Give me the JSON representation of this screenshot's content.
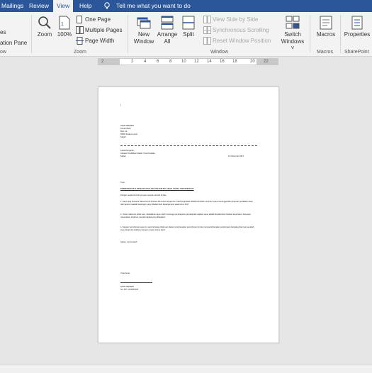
{
  "tabs": [
    "Mailings",
    "Review",
    "View",
    "Help"
  ],
  "tell_me": "Tell me what you want to do",
  "ribbon": {
    "partial_left": [
      "es",
      "ation Pane",
      "ow"
    ],
    "zoom": {
      "zoom": "Zoom",
      "pct": "100%",
      "one_page": "One Page",
      "multiple_pages": "Multiple Pages",
      "page_width": "Page Width",
      "group": "Zoom"
    },
    "window": {
      "new_window": [
        "New",
        "Window"
      ],
      "arrange_all": [
        "Arrange",
        "All"
      ],
      "split": "Split",
      "side_by_side": "View Side by Side",
      "sync_scroll": "Synchronous Scrolling",
      "reset_pos": "Reset Window Position",
      "switch": [
        "Switch",
        "Windows ˅"
      ],
      "group": "Window"
    },
    "macros": {
      "label": "Macros",
      "group": "Macros"
    },
    "sharepoint": {
      "label": "Properties",
      "group": "SharePoint"
    }
  },
  "ruler": {
    "ticks": [
      "2",
      "2",
      "4",
      "6",
      "8",
      "10",
      "12",
      "14",
      "16",
      "18",
      "20",
      "22"
    ]
  },
  "document": {
    "sender": [
      "NAMA SENDER",
      "Taman Book,",
      "Blok 1/2,",
      "56000 Kuala Lumpur,",
      "Sabah."
    ],
    "recipient": [
      "Ketua Pengarah,",
      "Jabatan Pendidikan Sabah, Kota Kinabalu,",
      "Sabah."
    ],
    "date": "21 November 2017",
    "salutation": "Tuan,",
    "subject": "PERMOHONAN PENANGGUHAN PINJAMAN ANAK MARA PENDIDIKAN",
    "greeting": "Dengan segala hormatnya saya merujuk perkara di atas.",
    "paragraphs": [
      "2.    Saya yang bernama Nama Penuh di Nama Pemohon dengan No. Kad Pengenalan 000000-00-0000 memohon untuk menangguhkan pinjaman pendidikan saya oleh kerana masalah kewangan yang dihadapi oleh keluarga saya sejak tahun 2017.",
      "3.    Untuk makluman pihak tuan, disebabkan saya masih menunggu pembayaran gaji daripada majikan saya, adalah dimaklumkan bahawa saya belum berupaya melunaskan pinjaman mengikut jadual yang ditetapkan.",
      "4.    Dengan permohonan saya ini, saya berharap pihak tuan dapat menimbangkan permohonan ini dan mempertimbangkan pertolongan daripada pihak tuan amatlah saya hargai dan didahului dengan ucapan terima kasih."
    ],
    "closing": "Sekian, terima kasih.",
    "sign_off": "Yang benar,",
    "signature_name": "NAMA SENDER",
    "signature_ic": "No. K/P: 00-0000-000"
  }
}
